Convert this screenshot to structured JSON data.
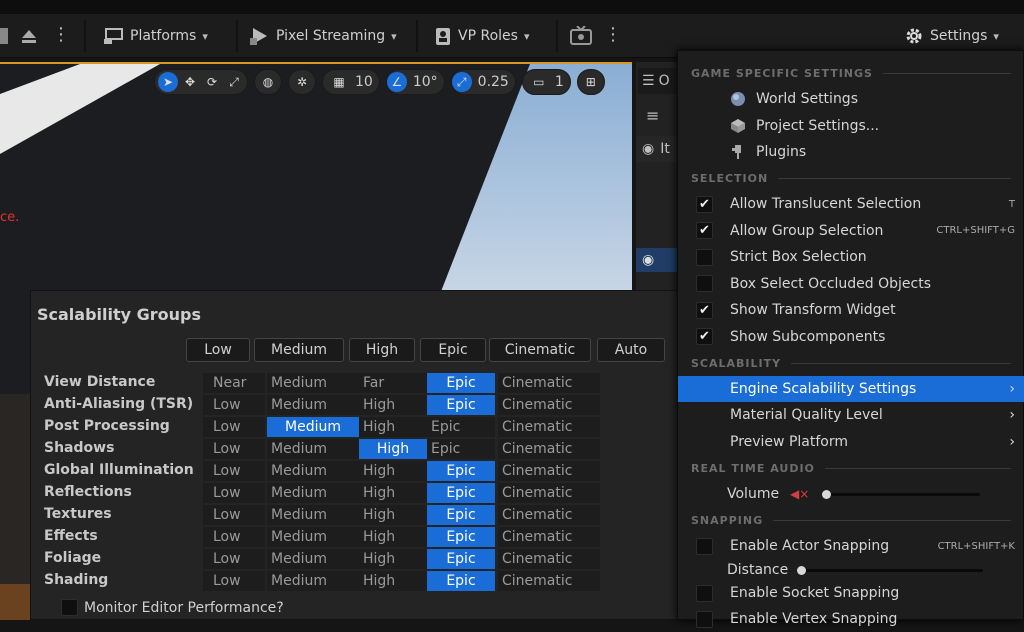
{
  "toolbar": {
    "platforms": "Platforms",
    "pixel_streaming": "Pixel Streaming",
    "vp_roles": "VP Roles",
    "settings": "Settings"
  },
  "viewport": {
    "grid_size": "10",
    "rotation_snap": "10°",
    "scale_snap": "0.25",
    "camera_speed": "1",
    "warning_text": "ce."
  },
  "outliner": {
    "tab_label": "O",
    "item_label": "It"
  },
  "scalability": {
    "title": "Scalability Groups",
    "headers": [
      "Low",
      "Medium",
      "High",
      "Epic",
      "Cinematic",
      "Auto"
    ],
    "rows": [
      {
        "label": "View Distance",
        "cells": [
          "Near",
          "Medium",
          "Far",
          "Epic",
          "Cinematic"
        ],
        "selected": 3
      },
      {
        "label": "Anti-Aliasing (TSR)",
        "cells": [
          "Low",
          "Medium",
          "High",
          "Epic",
          "Cinematic"
        ],
        "selected": 3
      },
      {
        "label": "Post Processing",
        "cells": [
          "Low",
          "Medium",
          "High",
          "Epic",
          "Cinematic"
        ],
        "selected": 1
      },
      {
        "label": "Shadows",
        "cells": [
          "Low",
          "Medium",
          "High",
          "Epic",
          "Cinematic"
        ],
        "selected": 2
      },
      {
        "label": "Global Illumination",
        "cells": [
          "Low",
          "Medium",
          "High",
          "Epic",
          "Cinematic"
        ],
        "selected": 3
      },
      {
        "label": "Reflections",
        "cells": [
          "Low",
          "Medium",
          "High",
          "Epic",
          "Cinematic"
        ],
        "selected": 3
      },
      {
        "label": "Textures",
        "cells": [
          "Low",
          "Medium",
          "High",
          "Epic",
          "Cinematic"
        ],
        "selected": 3
      },
      {
        "label": "Effects",
        "cells": [
          "Low",
          "Medium",
          "High",
          "Epic",
          "Cinematic"
        ],
        "selected": 3
      },
      {
        "label": "Foliage",
        "cells": [
          "Low",
          "Medium",
          "High",
          "Epic",
          "Cinematic"
        ],
        "selected": 3
      },
      {
        "label": "Shading",
        "cells": [
          "Low",
          "Medium",
          "High",
          "Epic",
          "Cinematic"
        ],
        "selected": 3
      }
    ],
    "monitor_label": "Monitor Editor Performance?"
  },
  "menu": {
    "sections": {
      "game": "GAME SPECIFIC SETTINGS",
      "selection": "SELECTION",
      "scalability": "SCALABILITY",
      "audio": "REAL TIME AUDIO",
      "snapping": "SNAPPING"
    },
    "world_settings": "World Settings",
    "project_settings": "Project Settings...",
    "plugins": "Plugins",
    "selection_items": [
      {
        "label": "Allow Translucent Selection",
        "shortcut": "T",
        "checked": true
      },
      {
        "label": "Allow Group Selection",
        "shortcut": "CTRL+SHIFT+G",
        "checked": true
      },
      {
        "label": "Strict Box Selection",
        "shortcut": "",
        "checked": false
      },
      {
        "label": "Box Select Occluded Objects",
        "shortcut": "",
        "checked": false
      },
      {
        "label": "Show Transform Widget",
        "shortcut": "",
        "checked": true
      },
      {
        "label": "Show Subcomponents",
        "shortcut": "",
        "checked": true
      }
    ],
    "engine_scalability": "Engine Scalability Settings",
    "material_quality": "Material Quality Level",
    "preview_platform": "Preview Platform",
    "volume": "Volume",
    "volume_level": 0.0,
    "enable_actor_snapping": "Enable Actor Snapping",
    "actor_snap_shortcut": "CTRL+SHIFT+K",
    "distance": "Distance",
    "distance_level": 0.0,
    "enable_socket_snapping": "Enable Socket Snapping",
    "enable_vertex_snapping": "Enable Vertex Snapping"
  },
  "colors": {
    "accent": "#1a6dd6",
    "viewport_border": "#d69a22"
  }
}
